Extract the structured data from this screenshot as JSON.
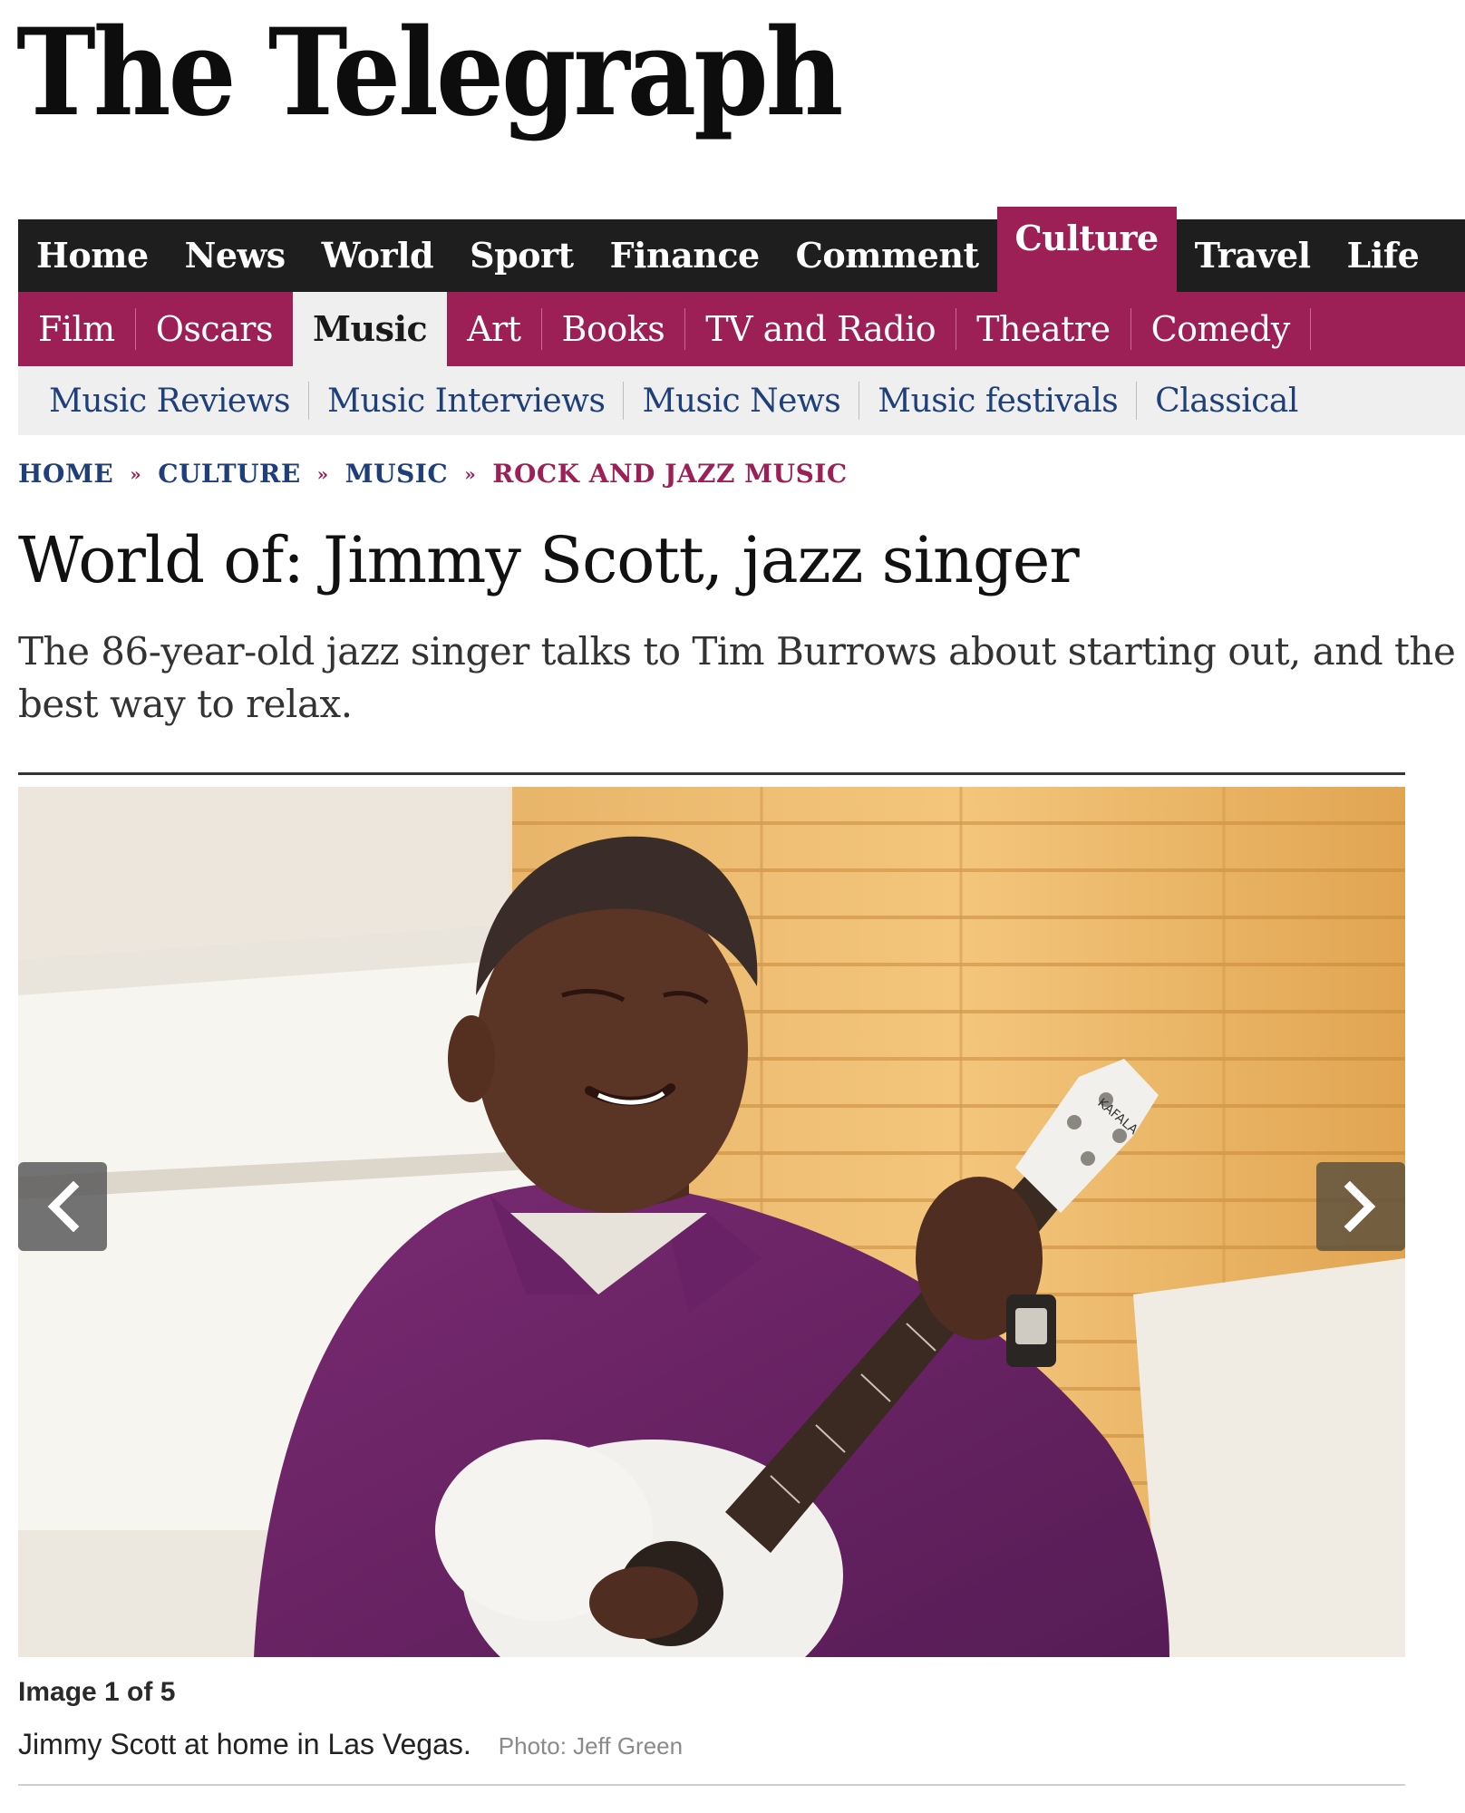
{
  "masthead": {
    "title": "The Telegraph"
  },
  "nav_primary": {
    "items": [
      {
        "label": "Home"
      },
      {
        "label": "News"
      },
      {
        "label": "World"
      },
      {
        "label": "Sport"
      },
      {
        "label": "Finance"
      },
      {
        "label": "Comment"
      },
      {
        "label": "Culture",
        "active": true
      },
      {
        "label": "Travel"
      },
      {
        "label": "Life"
      }
    ]
  },
  "nav_secondary": {
    "items": [
      {
        "label": "Film"
      },
      {
        "label": "Oscars"
      },
      {
        "label": "Music",
        "active": true
      },
      {
        "label": "Art"
      },
      {
        "label": "Books"
      },
      {
        "label": "TV and Radio"
      },
      {
        "label": "Theatre"
      },
      {
        "label": "Comedy"
      }
    ]
  },
  "nav_tertiary": {
    "items": [
      {
        "label": "Music Reviews"
      },
      {
        "label": "Music Interviews"
      },
      {
        "label": "Music News"
      },
      {
        "label": "Music festivals"
      },
      {
        "label": "Classical"
      }
    ]
  },
  "breadcrumb": {
    "items": [
      {
        "label": "HOME"
      },
      {
        "label": "CULTURE"
      },
      {
        "label": "MUSIC"
      },
      {
        "label": "ROCK AND JAZZ MUSIC",
        "current": true
      }
    ],
    "separator": "»"
  },
  "article": {
    "headline": "World of: Jimmy Scott, jazz singer",
    "standfirst": "The 86-year-old jazz singer talks to Tim Burrows about starting out, and the best way to relax."
  },
  "gallery": {
    "counter": "Image 1 of 5",
    "caption": "Jimmy Scott at home in Las Vegas.",
    "credit": "Photo: Jeff Green",
    "ukulele_brand": "KAFALA"
  },
  "colors": {
    "brand": "#9c1f55",
    "nav_dark": "#1e1e1e",
    "link_blue": "#1f3f7a",
    "subnav_bg": "#efefef"
  }
}
